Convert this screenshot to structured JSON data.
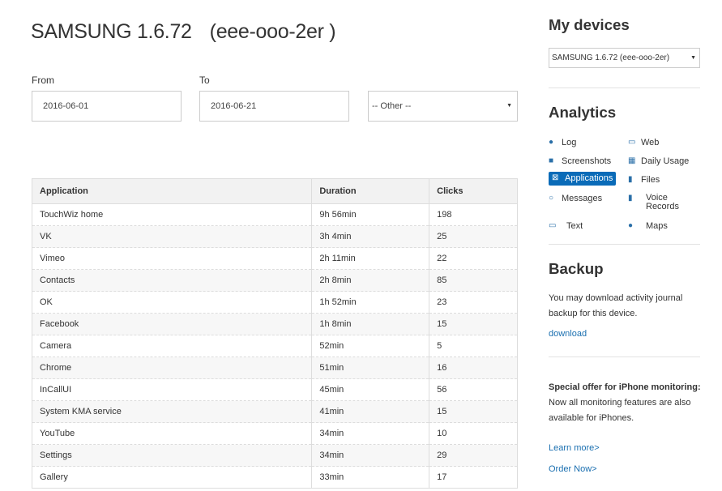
{
  "device": {
    "model": "SAMSUNG 1.6.72",
    "serial": "(eee-ooo-2er )"
  },
  "filters": {
    "from_label": "From",
    "to_label": "To",
    "from_value": "2016-06-01",
    "to_value": "2016-06-21",
    "period_value": "-- Other --"
  },
  "table": {
    "headers": [
      "Application",
      "Duration",
      "Clicks"
    ],
    "rows": [
      [
        "TouchWiz home",
        "9h 56min",
        "198"
      ],
      [
        "VK",
        "3h 4min",
        "25"
      ],
      [
        "Vimeo",
        "2h 11min",
        "22"
      ],
      [
        "Contacts",
        "2h 8min",
        "85"
      ],
      [
        "OK",
        "1h 52min",
        "23"
      ],
      [
        "Facebook",
        "1h 8min",
        "15"
      ],
      [
        "Camera",
        "52min",
        "5"
      ],
      [
        "Chrome",
        "51min",
        "16"
      ],
      [
        "InCallUI",
        "45min",
        "56"
      ],
      [
        "System KMA service",
        "41min",
        "15"
      ],
      [
        "YouTube",
        "34min",
        "10"
      ],
      [
        "Settings",
        "34min",
        "29"
      ],
      [
        "Gallery",
        "33min",
        "17"
      ]
    ]
  },
  "sidebar": {
    "my_devices_title": "My devices",
    "device_select": "SAMSUNG 1.6.72 (eee-ooo-2er)",
    "analytics_title": "Analytics",
    "nav": {
      "log": "Log",
      "web": "Web",
      "screenshots": "Screenshots",
      "daily_usage": "Daily Usage",
      "applications": "Applications",
      "files": "Files",
      "messages": "Messages",
      "voice_records": "Voice Records",
      "text": "Text",
      "maps": "Maps"
    },
    "icons": {
      "log": "eye-icon",
      "web": "monitor-icon",
      "screenshots": "camera-icon",
      "daily_usage": "calendar-icon",
      "applications": "app-window-icon",
      "files": "file-icon",
      "messages": "chat-icon",
      "voice_records": "microphone-icon",
      "text": "keyboard-icon",
      "maps": "globe-icon"
    },
    "backup_title": "Backup",
    "backup_text": "You may download activity journal backup for this device.",
    "download_link": "download",
    "offer_title": "Special offer for iPhone monitoring:",
    "offer_text": "Now all monitoring features are also available for iPhones.",
    "learn_more": "Learn more>",
    "order_now": "Order Now>"
  },
  "colors": {
    "accent": "#0a6bb8",
    "link": "#1a6fb0"
  }
}
